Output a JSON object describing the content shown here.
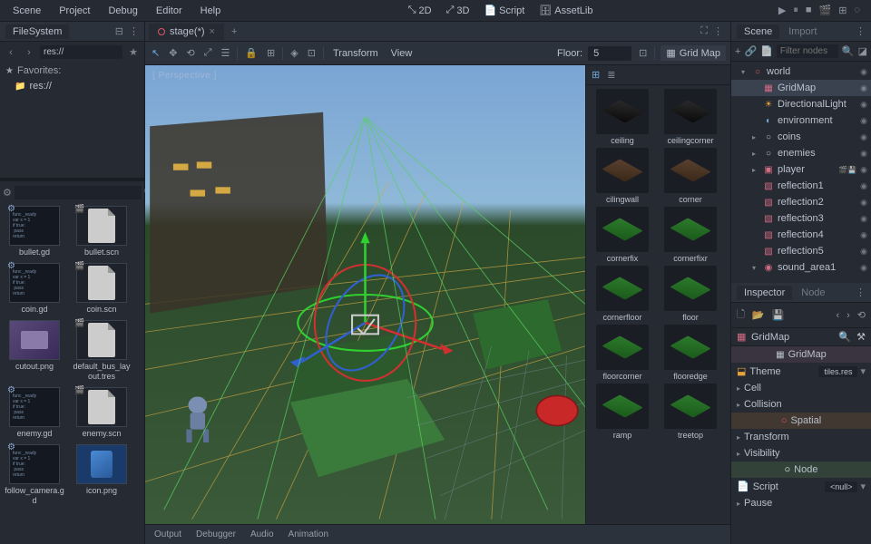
{
  "menu": {
    "items": [
      "Scene",
      "Project",
      "Debug",
      "Editor",
      "Help"
    ],
    "center": [
      {
        "label": "2D",
        "active": false,
        "icon": "⤡"
      },
      {
        "label": "3D",
        "active": true,
        "icon": "⤢"
      },
      {
        "label": "Script",
        "active": false,
        "icon": "📄"
      },
      {
        "label": "AssetLib",
        "active": false,
        "icon": "🗄"
      }
    ]
  },
  "filesystem": {
    "title": "FileSystem",
    "path": "res://",
    "favorites": "Favorites:",
    "root": "res://",
    "items": [
      {
        "name": "bullet.gd",
        "type": "script"
      },
      {
        "name": "bullet.scn",
        "type": "scene"
      },
      {
        "name": "coin.gd",
        "type": "script"
      },
      {
        "name": "coin.scn",
        "type": "scene"
      },
      {
        "name": "cutout.png",
        "type": "image"
      },
      {
        "name": "default_bus_layout.tres",
        "type": "scene"
      },
      {
        "name": "enemy.gd",
        "type": "script"
      },
      {
        "name": "enemy.scn",
        "type": "scene"
      },
      {
        "name": "follow_camera.gd",
        "type": "script"
      },
      {
        "name": "icon.png",
        "type": "image-lit"
      }
    ]
  },
  "editor": {
    "tab": "stage(*)",
    "perspective": "[ Perspective ]",
    "menus": [
      "Transform",
      "View"
    ],
    "floor_label": "Floor:",
    "floor": "5",
    "gridmap": "Grid Map"
  },
  "meshes": [
    "ceiling",
    "ceilingcorner",
    "cilingwall",
    "corner",
    "cornerfix",
    "cornerfixr",
    "cornerfloor",
    "floor",
    "floorcorner",
    "flooredge",
    "ramp",
    "treetop"
  ],
  "bottom": [
    "Output",
    "Debugger",
    "Audio",
    "Animation"
  ],
  "scene": {
    "tabs": [
      "Scene",
      "Import"
    ],
    "filter_placeholder": "Filter nodes",
    "tree": [
      {
        "name": "world",
        "depth": 0,
        "icon": "○",
        "color": "#e05666",
        "chev": "▾",
        "eye": true
      },
      {
        "name": "GridMap",
        "depth": 1,
        "icon": "▦",
        "color": "#d76b84",
        "sel": true,
        "eye": true
      },
      {
        "name": "DirectionalLight",
        "depth": 1,
        "icon": "☀",
        "color": "#e8a23a",
        "eye": true
      },
      {
        "name": "environment",
        "depth": 1,
        "icon": "◐",
        "color": "#7aa5d4",
        "eye": true
      },
      {
        "name": "coins",
        "depth": 1,
        "icon": "○",
        "color": "#b8c0cc",
        "chev": "▸",
        "eye": true
      },
      {
        "name": "enemies",
        "depth": 1,
        "icon": "○",
        "color": "#b8c0cc",
        "chev": "▸",
        "eye": true
      },
      {
        "name": "player",
        "depth": 1,
        "icon": "▣",
        "color": "#d76b84",
        "chev": "▸",
        "extra": true,
        "eye": true
      },
      {
        "name": "reflection1",
        "depth": 1,
        "icon": "▧",
        "color": "#d76b84",
        "eye": true
      },
      {
        "name": "reflection2",
        "depth": 1,
        "icon": "▧",
        "color": "#d76b84",
        "eye": true
      },
      {
        "name": "reflection3",
        "depth": 1,
        "icon": "▧",
        "color": "#d76b84",
        "eye": true
      },
      {
        "name": "reflection4",
        "depth": 1,
        "icon": "▧",
        "color": "#d76b84",
        "eye": true
      },
      {
        "name": "reflection5",
        "depth": 1,
        "icon": "▧",
        "color": "#d76b84",
        "eye": true
      },
      {
        "name": "sound_area1",
        "depth": 1,
        "icon": "◉",
        "color": "#d76b84",
        "chev": "▾",
        "eye": true
      }
    ]
  },
  "inspector": {
    "tabs": [
      "Inspector",
      "Node"
    ],
    "obj": "GridMap",
    "cat": "GridMap",
    "theme_label": "Theme",
    "theme_val": "tiles.res",
    "sections": [
      "Cell",
      "Collision"
    ],
    "spatial": "Spatial",
    "spatial_sections": [
      "Transform",
      "Visibility"
    ],
    "node": "Node",
    "script_label": "Script",
    "script_val": "<null>",
    "pause": "Pause"
  }
}
